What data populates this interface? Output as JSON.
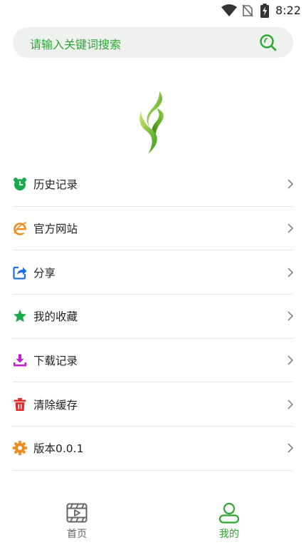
{
  "status_bar": {
    "time": "8:22",
    "icons": [
      "wifi-icon",
      "no-sim-icon",
      "battery-charging-icon"
    ]
  },
  "search": {
    "placeholder": "请输入关键词搜索",
    "icon": "search-icon"
  },
  "logo": {
    "icon": "leaf-logo"
  },
  "menu": {
    "items": [
      {
        "label": "历史记录",
        "icon": "alarm-clock-icon",
        "color": "#1aa94b"
      },
      {
        "label": "官方网站",
        "icon": "browser-e-icon",
        "color": "#f08c1a"
      },
      {
        "label": "分享",
        "icon": "share-icon",
        "color": "#1f6fe0"
      },
      {
        "label": "我的收藏",
        "icon": "star-icon",
        "color": "#1aa94b"
      },
      {
        "label": "下载记录",
        "icon": "download-icon",
        "color": "#c21fd6"
      },
      {
        "label": "清除缓存",
        "icon": "trash-icon",
        "color": "#e52a2a"
      },
      {
        "label": "版本0.0.1",
        "icon": "gear-icon",
        "color": "#f08c1a"
      }
    ]
  },
  "bottom_nav": {
    "tabs": [
      {
        "label": "首页",
        "icon": "film-icon",
        "active": false
      },
      {
        "label": "我的",
        "icon": "user-icon",
        "active": true
      }
    ]
  },
  "colors": {
    "accent": "#2aa832",
    "search_bg": "#eef1ee",
    "divider": "#e6e6e6"
  }
}
